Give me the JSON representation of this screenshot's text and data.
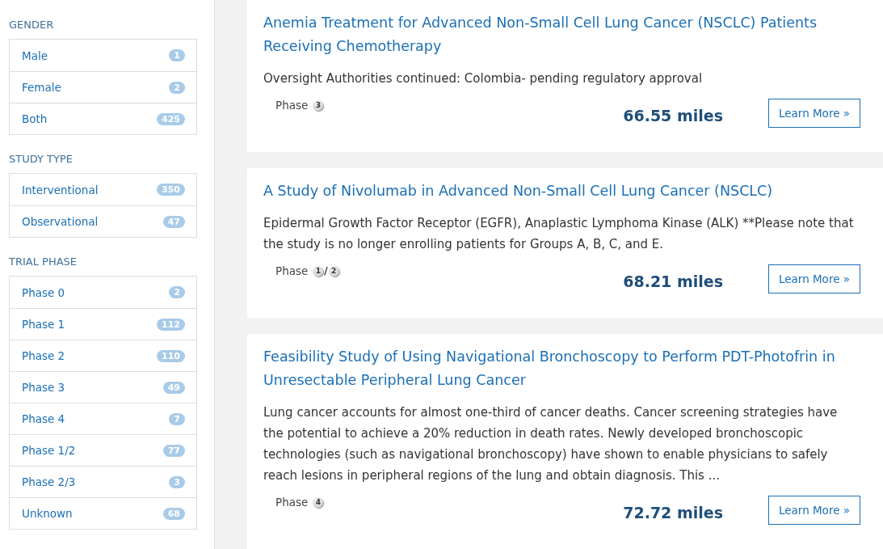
{
  "filters": [
    {
      "heading": "GENDER",
      "items": [
        {
          "label": "Male",
          "count": "1"
        },
        {
          "label": "Female",
          "count": "2"
        },
        {
          "label": "Both",
          "count": "425"
        }
      ]
    },
    {
      "heading": "STUDY TYPE",
      "items": [
        {
          "label": "Interventional",
          "count": "350"
        },
        {
          "label": "Observational",
          "count": "47"
        }
      ]
    },
    {
      "heading": "TRIAL PHASE",
      "items": [
        {
          "label": "Phase 0",
          "count": "2"
        },
        {
          "label": "Phase 1",
          "count": "112"
        },
        {
          "label": "Phase 2",
          "count": "110"
        },
        {
          "label": "Phase 3",
          "count": "49"
        },
        {
          "label": "Phase 4",
          "count": "7"
        },
        {
          "label": "Phase 1/2",
          "count": "77"
        },
        {
          "label": "Phase 2/3",
          "count": "3"
        },
        {
          "label": "Unknown",
          "count": "68"
        }
      ]
    }
  ],
  "results": [
    {
      "title": "Anemia Treatment for Advanced Non-Small Cell Lung Cancer (NSCLC) Patients Receiving Chemotherapy",
      "description": "Oversight Authorities continued: Colombia- pending regulatory approval",
      "phase_label": "Phase",
      "phase_numbers": [
        "3"
      ],
      "distance": "66.55 miles",
      "button": "Learn More »"
    },
    {
      "title": "A Study of Nivolumab in Advanced Non-Small Cell Lung Cancer (NSCLC)",
      "description": "Epidermal Growth Factor Receptor (EGFR), Anaplastic Lymphoma Kinase (ALK) **Please note that the study is no longer enrolling patients for Groups A, B, C, and E.",
      "phase_label": "Phase",
      "phase_numbers": [
        "1",
        "2"
      ],
      "phase_separator": "/",
      "distance": "68.21 miles",
      "button": "Learn More »"
    },
    {
      "title": "Feasibility Study of Using Navigational Bronchoscopy to Perform PDT-Photofrin in Unresectable Peripheral Lung Cancer",
      "description": "Lung cancer accounts for almost one-third of cancer deaths. Cancer screening strategies have the potential to achieve a 20% reduction in death rates. Newly developed bronchoscopic technologies (such as navigational bronchoscopy) have shown to enable physicians to safely reach lesions in peripheral regions of the lung and obtain diagnosis. This ...",
      "phase_label": "Phase",
      "phase_numbers": [
        "4"
      ],
      "distance": "72.72 miles",
      "button": "Learn More »"
    }
  ]
}
